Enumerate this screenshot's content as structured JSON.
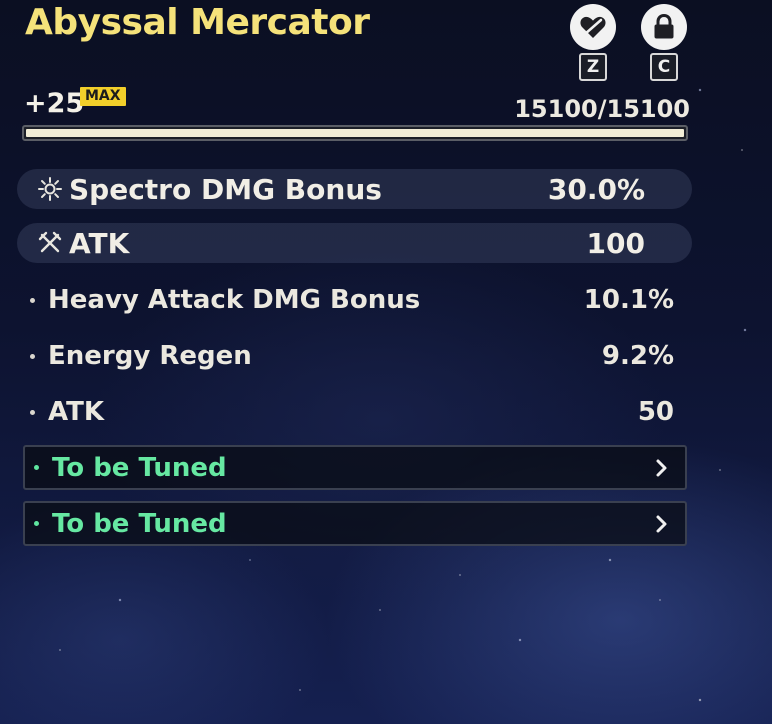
{
  "echo": {
    "name": "Abyssal Mercator",
    "level": "+25",
    "level_badge": "MAX",
    "exp_text": "15100/15100",
    "exp_fill": 1.0
  },
  "actions": {
    "discard_key": "Z",
    "lock_key": "C",
    "discard_icon": "heart-slash-icon",
    "lock_icon": "lock-icon"
  },
  "main_stats": [
    {
      "icon": "spectro-icon",
      "name": "Spectro DMG Bonus",
      "value": "30.0%"
    },
    {
      "icon": "atk-swords-icon",
      "name": "ATK",
      "value": "100"
    }
  ],
  "sub_stats": [
    {
      "name": "Heavy Attack DMG Bonus",
      "value": "10.1%"
    },
    {
      "name": "Energy Regen",
      "value": "9.2%"
    },
    {
      "name": "ATK",
      "value": "50"
    }
  ],
  "tune_slots": [
    {
      "label": "To be Tuned"
    },
    {
      "label": "To be Tuned"
    }
  ],
  "colors": {
    "title": "#f5e27a",
    "badge": "#f2cf2a",
    "tune_text": "#66e8a2",
    "bar_fill": "#f2edd7"
  }
}
